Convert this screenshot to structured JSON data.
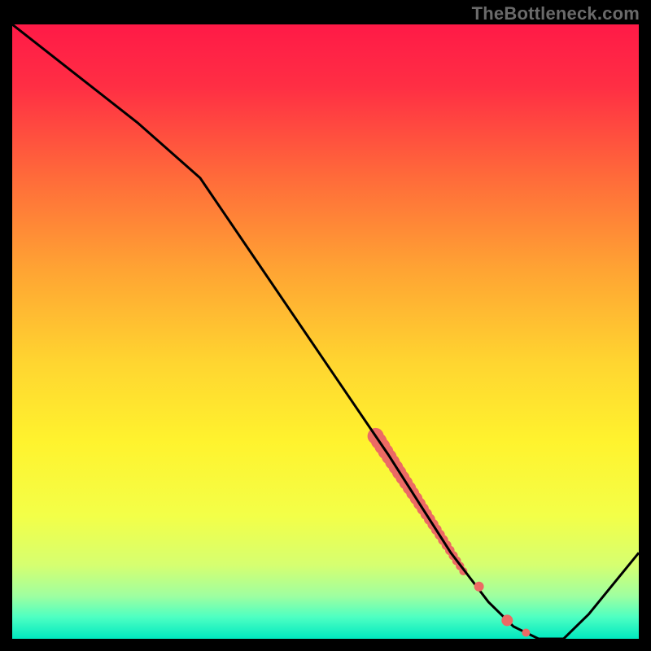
{
  "watermark": "TheBottleneck.com",
  "colors": {
    "frame": "#000000",
    "watermark_text": "#6a6a6a",
    "curve": "#000000",
    "marker": "#ec6a64",
    "gradient_stops": [
      {
        "offset": 0.0,
        "color": "#ff1a47"
      },
      {
        "offset": 0.1,
        "color": "#ff2e44"
      },
      {
        "offset": 0.25,
        "color": "#ff6b3a"
      },
      {
        "offset": 0.4,
        "color": "#ffa433"
      },
      {
        "offset": 0.55,
        "color": "#ffd530"
      },
      {
        "offset": 0.68,
        "color": "#fff32e"
      },
      {
        "offset": 0.8,
        "color": "#f3ff48"
      },
      {
        "offset": 0.88,
        "color": "#d6ff70"
      },
      {
        "offset": 0.93,
        "color": "#9fffa0"
      },
      {
        "offset": 0.965,
        "color": "#4dffc2"
      },
      {
        "offset": 1.0,
        "color": "#00e8c0"
      }
    ]
  },
  "chart_data": {
    "type": "line",
    "title": "",
    "xlabel": "",
    "ylabel": "",
    "xlim": [
      0,
      100
    ],
    "ylim": [
      0,
      100
    ],
    "series": [
      {
        "name": "bottleneck-curve",
        "x": [
          0,
          10,
          20,
          30,
          40,
          50,
          60,
          65,
          70,
          73,
          76,
          80,
          84,
          88,
          92,
          100
        ],
        "y": [
          100,
          92,
          84,
          75,
          60,
          45,
          30,
          22,
          14,
          10,
          6,
          2,
          0,
          0,
          4,
          14
        ]
      }
    ],
    "highlight_band": {
      "comment": "thick salmon segment along the descending curve",
      "x": [
        58,
        72
      ],
      "y": [
        33,
        11
      ]
    },
    "markers": [
      {
        "x": 74.5,
        "y": 8.5
      },
      {
        "x": 79.0,
        "y": 3.0
      },
      {
        "x": 82.0,
        "y": 1.0
      }
    ]
  }
}
